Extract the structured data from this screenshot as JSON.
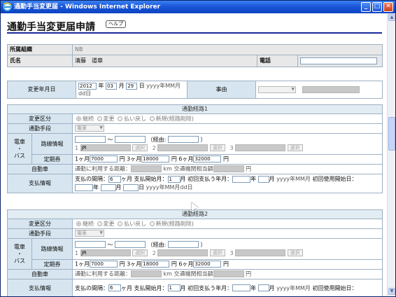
{
  "window": {
    "title": "通勤手当変更届 - Windows Internet Explorer",
    "min": "_",
    "max": "□",
    "close": "✕"
  },
  "page": {
    "title": "通勤手当変更届申請",
    "help": "ヘルプ"
  },
  "info": {
    "org_label": "所属組織",
    "org_value": "NB",
    "name_label": "氏名",
    "name_value": "清藤　道章",
    "phone_label": "電話",
    "phone_value": ""
  },
  "change": {
    "date_label": "変更年月日",
    "year": "2012",
    "year_unit": "年",
    "month": "03",
    "month_unit": "月",
    "day": "29",
    "day_unit": "日",
    "format_hint": "yyyy年MM月dd日",
    "reason_label": "事由"
  },
  "common": {
    "kubun_label": "変更区分",
    "kubun_options": [
      "継続",
      "変更",
      "払い戻し",
      "新規(経路削除)"
    ],
    "shudan_label": "通勤手段",
    "shudan_value": "電車",
    "train_label_1": "電車",
    "train_label_2": "・",
    "train_label_3": "バス",
    "route_label": "路線情報",
    "tilde": "～",
    "via_open": "（経由:",
    "via_close": "）",
    "n1": "1",
    "n2": "2",
    "n3": "3",
    "line1": "JR",
    "select_label": "選択",
    "teiki_label": "定期券",
    "m1_label": "1ヶ月",
    "m1": "7000",
    "m3_label": "円 3ヶ月",
    "m3": "18000",
    "m6_label": "円 6ヶ月",
    "m6": "32000",
    "yen": "円",
    "car_label": "自動車",
    "car_distance_label": "通勤に利用する距離：",
    "car_km": "km",
    "car_cost_label": "交通機関相当額",
    "pay_label": "支払情報",
    "interval_label": "支払の間隔：",
    "interval": "6",
    "interval_unit": "ヶ月",
    "start_label": "支払開始月：",
    "start_month": "1",
    "start_unit": "月",
    "first_label": "初回支払う年月：",
    "first_year_unit": "年",
    "first_month_unit": "月",
    "first_hint": "yyyy年MM月",
    "first_use_label": "初回使用開始日：",
    "date_year_unit": "年",
    "date_month_unit": "月",
    "date_day_unit": "日",
    "date_hint": "yyyy年MM月dd日"
  },
  "route1": {
    "header": "通勤経路1"
  },
  "route2": {
    "header": "通勤経路2"
  }
}
